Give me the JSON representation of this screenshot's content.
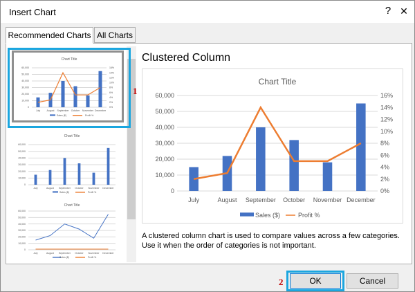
{
  "window": {
    "title": "Insert Chart",
    "help_label": "?",
    "close_label": "✕"
  },
  "tabs": [
    {
      "label": "Recommended Charts",
      "active": true
    },
    {
      "label": "All Charts",
      "active": false
    }
  ],
  "thumbnails": [
    {
      "type": "clustered-column-line",
      "title": "Chart Title",
      "selected": true
    },
    {
      "type": "clustered-column",
      "title": "Chart Title",
      "selected": false
    },
    {
      "type": "line",
      "title": "Chart Title",
      "selected": false
    }
  ],
  "thumbnail_legend": {
    "sales": "Sales ($)",
    "profit": "Profit %"
  },
  "steps": {
    "one": "1",
    "two": "2"
  },
  "detail": {
    "heading": "Clustered Column",
    "description": "A clustered column chart is used to compare values across a few categories. Use it when the order of categories is not important."
  },
  "buttons": {
    "ok": "OK",
    "cancel": "Cancel"
  },
  "colors": {
    "selection": "#1ba6df",
    "column": "#4472c4",
    "line": "#ed7d31",
    "step": "#c00000"
  },
  "chart_data": {
    "type": "bar",
    "title": "Chart Title",
    "categories": [
      "July",
      "August",
      "September",
      "October",
      "November",
      "December"
    ],
    "series": [
      {
        "name": "Sales ($)",
        "type": "bar",
        "axis": "left",
        "values": [
          15000,
          22000,
          40000,
          32000,
          18000,
          55000
        ]
      },
      {
        "name": "Profit %",
        "type": "line",
        "axis": "right",
        "values": [
          0.02,
          0.03,
          0.14,
          0.05,
          0.05,
          0.08
        ]
      }
    ],
    "ylim": [
      0,
      60000
    ],
    "y_ticks": [
      "0",
      "10,000",
      "20,000",
      "30,000",
      "40,000",
      "50,000",
      "60,000"
    ],
    "y2lim": [
      0,
      0.16
    ],
    "y2_ticks": [
      "0%",
      "2%",
      "4%",
      "6%",
      "8%",
      "10%",
      "12%",
      "14%",
      "16%"
    ],
    "grid": true,
    "legend": "bottom"
  }
}
